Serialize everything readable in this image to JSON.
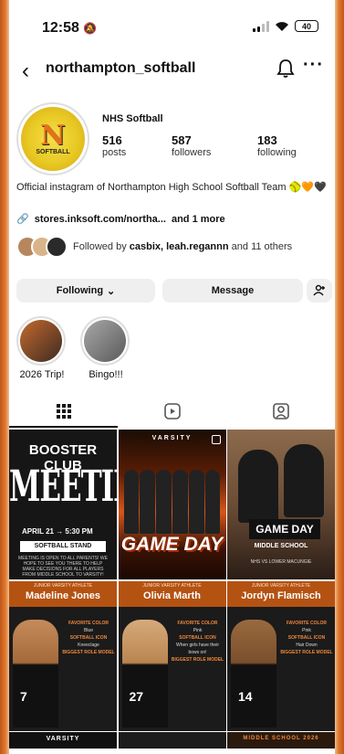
{
  "status_bar": {
    "time": "12:58",
    "battery": "40"
  },
  "header": {
    "username": "northampton_softball"
  },
  "profile": {
    "name": "NHS Softball",
    "logo_letter": "N",
    "logo_text": "SOFTBALL",
    "stats": [
      {
        "value": "516",
        "label": "posts"
      },
      {
        "value": "587",
        "label": "followers"
      },
      {
        "value": "183",
        "label": "following"
      }
    ],
    "bio": "Official instagram of Northampton High School Softball Team 🥎🧡🖤",
    "link": "stores.inksoft.com/northa...",
    "link_more": "and 1 more",
    "followed_by_prefix": "Followed by",
    "followed_by_names": "casbix, leah.regannn",
    "followed_by_suffix": "and 11 others"
  },
  "actions": {
    "following": "Following",
    "message": "Message"
  },
  "highlights": [
    {
      "label": "2026 Trip!"
    },
    {
      "label": "Bingo!!!"
    }
  ],
  "posts": {
    "p1": {
      "line1": "BOOSTER CLUB",
      "line2": "MEETING",
      "date": "APRIL 21  →  5:30 PM",
      "place": "SOFTBALL STAND",
      "note": "MEETING IS OPEN TO ALL PARENTS! WE HOPE TO SEE YOU THERE TO HELP MAKE DECISIONS FOR ALL PLAYERS FROM MIDDLE SCHOOL TO VARSITY!"
    },
    "p2": {
      "top": "VARSITY",
      "title": "GAME DAY"
    },
    "p3": {
      "title": "GAME DAY",
      "sub": "MIDDLE SCHOOL",
      "note": "NHS VS LOWER MACUNGIE"
    },
    "p4": {
      "caption": "JUNIOR VARSITY ATHLETE",
      "name": "Madeline Jones",
      "l1": "FAVORITE COLOR",
      "v1": "Blue",
      "l2": "SOFTBALL ICON",
      "v2": "Kneeclage",
      "l3": "BIGGEST ROLE MODEL",
      "number": "7"
    },
    "p5": {
      "caption": "JUNIOR VARSITY ATHLETE",
      "name": "Olivia Marth",
      "l1": "FAVORITE COLOR",
      "v1": "Pink",
      "l2": "SOFTBALL ICON",
      "v2": "When girls have their bows on!",
      "l3": "BIGGEST ROLE MODEL",
      "number": "27"
    },
    "p6": {
      "caption": "JUNIOR VARSITY ATHLETE",
      "name": "Jordyn Flamisch",
      "l1": "FAVORITE COLOR",
      "v1": "Pink",
      "l2": "SOFTBALL ICON",
      "v2": "Hair Down",
      "l3": "BIGGEST ROLE MODEL",
      "number": "14"
    },
    "p7": {
      "text": "VARSITY"
    },
    "p9": {
      "text": "MIDDLE SCHOOL 2026"
    }
  },
  "colors": {
    "accent_orange": "#e07a2c",
    "text": "#111111",
    "button_bg": "#efefef"
  }
}
